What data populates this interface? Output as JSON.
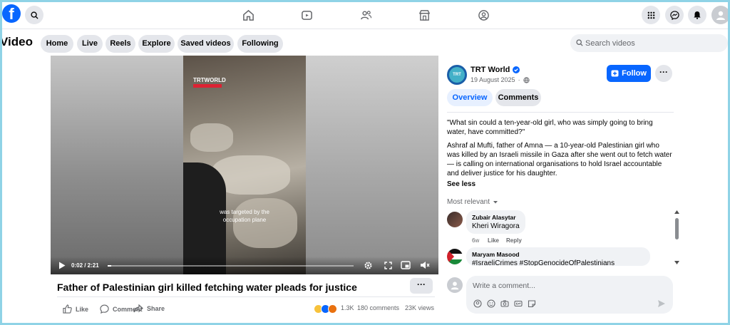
{
  "topbar": {
    "logo": "f",
    "icons": [
      "search-icon",
      "home-icon",
      "video-icon",
      "friends-icon",
      "marketplace-icon",
      "groups-icon",
      "menu-grid-icon",
      "messenger-icon",
      "notifications-icon",
      "profile-avatar"
    ]
  },
  "subnav": {
    "title": "Video",
    "pills": [
      "Home",
      "Live",
      "Reels",
      "Explore",
      "Saved videos",
      "Following"
    ],
    "search_placeholder": "Search videos"
  },
  "video": {
    "watermark": "TRTWORLD",
    "caption_line1": "was targeted by the",
    "caption_line2": "occupation plane",
    "time": "0:02 / 2:21",
    "progress_fraction": 0.015,
    "title": "Father of Palestinian girl killed fetching water pleads for justice",
    "more_label": "···",
    "actions": {
      "like": "Like",
      "comment": "Comment",
      "share": "Share"
    },
    "reactions_count": "1.3K",
    "comments_count": "180 comments",
    "views": "23K views"
  },
  "post": {
    "page_name": "TRT World",
    "avatar_text": "TRT",
    "date": "19 August 2025",
    "follow_label": "Follow",
    "more_label": "···",
    "tabs": [
      "Overview",
      "Comments"
    ],
    "quote": "\"What sin could a ten-year-old girl, who was simply going to bring water, have committed?\"",
    "body": "Ashraf al Mufti, father of Amna — a 10-year-old Palestinian girl who was killed by an Israeli missile in Gaza after she went out to fetch water — is calling on international organisations to hold Israel accountable and deliver justice for his daughter.",
    "see_less": "See less",
    "sort_label": "Most relevant"
  },
  "comments": [
    {
      "name": "Zubair Alasytar",
      "text": "Kheri Wiragora",
      "age": "6w",
      "like": "Like",
      "reply": "Reply"
    },
    {
      "name": "Maryam Masood",
      "text": "#IsraeliCrimes #StopGenocideOfPalestinians"
    }
  ],
  "composer": {
    "placeholder": "Write a comment..."
  },
  "colors": {
    "accent": "#0866ff",
    "page_bg": "#8fd3e6",
    "pill_bg": "#e4e6eb"
  }
}
